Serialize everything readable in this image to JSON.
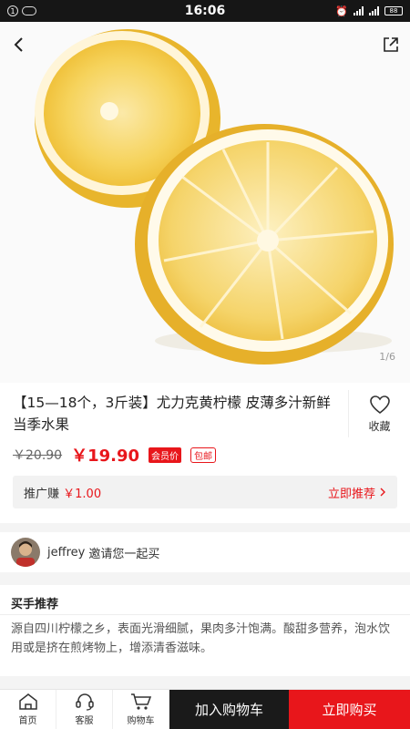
{
  "status_bar": {
    "time": "16:06",
    "left_badge": "1",
    "battery": "88"
  },
  "hero": {
    "image_counter": "1/6",
    "back_icon": "back-chevron-icon",
    "share_icon": "share-icon"
  },
  "product": {
    "title": "【15—18个，3斤装】尤力克黄柠檬 皮薄多汁新鲜当季水果",
    "favorite_label": "收藏",
    "old_price": "￥20.90",
    "new_price": "￥19.90",
    "member_badge": "会员价",
    "shipping_badge": "包邮",
    "promo_label": "推广赚",
    "promo_amount": "￥1.00",
    "promo_action": "立即推荐"
  },
  "invite": {
    "username": "jeffrey",
    "text": "邀请您一起买"
  },
  "recommend": {
    "title": "买手推荐",
    "text": "源自四川柠檬之乡，表面光滑细腻，果肉多汁饱满。酸甜多营养，泡水饮用或是挤在煎烤物上，增添清香滋味。"
  },
  "bottom_bar": {
    "home": "首页",
    "service": "客服",
    "cart": "购物车",
    "add_to_cart": "加入购物车",
    "buy_now": "立即购买"
  },
  "colors": {
    "accent": "#e8161b",
    "dark": "#1a1a1a"
  }
}
